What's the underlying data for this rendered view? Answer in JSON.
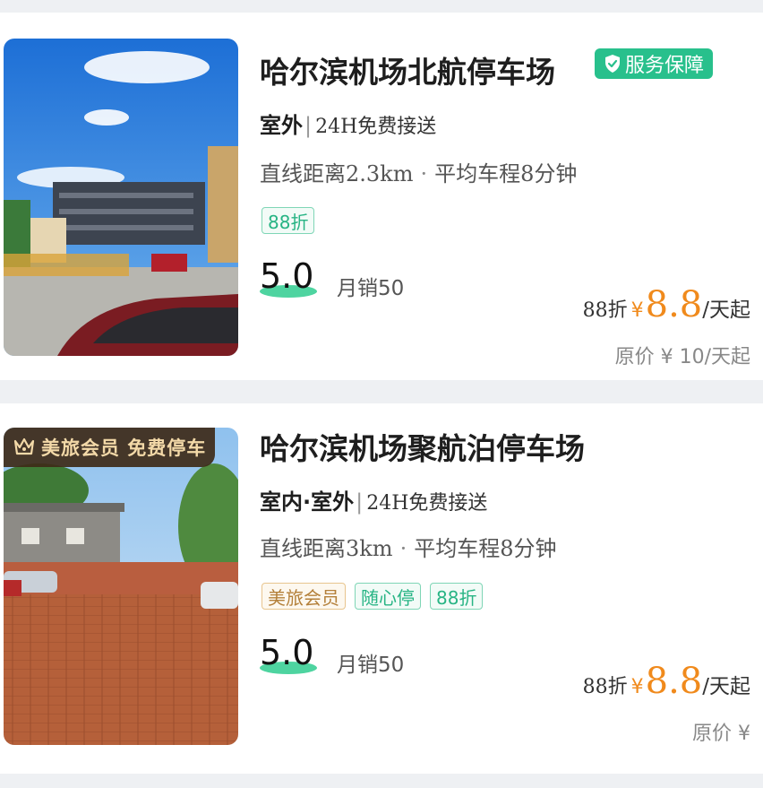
{
  "listings": [
    {
      "title": "哈尔滨机场北航停车场",
      "guarantee_label": "服务保障",
      "parking_type": "室外",
      "separator": "|",
      "service": "24H免费接送",
      "distance": "直线距离2.3km",
      "dot": "·",
      "drive_time": "平均车程8分钟",
      "tags": [
        "88折"
      ],
      "rating": "5.0",
      "monthly_sales": "月销50",
      "discount": "88折",
      "currency": "¥",
      "price": "8.8",
      "price_unit": "/天起",
      "original_price": "原价 ¥ 10/天起"
    },
    {
      "title": "哈尔滨机场聚航泊停车场",
      "member_badge": "美旅会员 免费停车",
      "parking_type": "室内·室外",
      "separator": "|",
      "service": "24H免费接送",
      "distance": "直线距离3km",
      "dot": "·",
      "drive_time": "平均车程8分钟",
      "tags": [
        "美旅会员",
        "随心停",
        "88折"
      ],
      "rating": "5.0",
      "monthly_sales": "月销50",
      "discount": "88折",
      "currency": "¥",
      "price": "8.8",
      "price_unit": "/天起",
      "original_price": "原价 ¥"
    }
  ],
  "colors": {
    "accent_green": "#28c08c",
    "price_orange": "#f08a1c",
    "member_gold": "#b4803a"
  }
}
